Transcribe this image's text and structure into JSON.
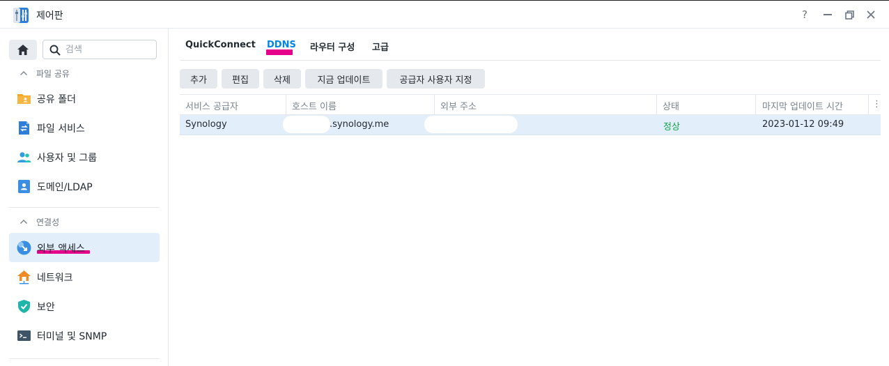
{
  "window": {
    "title": "제어판"
  },
  "window_controls": {
    "help": "?",
    "minimize": "—",
    "restore": "❐",
    "close": "✕"
  },
  "sidebar": {
    "search_placeholder": "검색",
    "sections": [
      {
        "label": "파일 공유",
        "items": [
          {
            "label": "공유 폴더",
            "icon": "shared-folder-icon",
            "color": "#f5a623"
          },
          {
            "label": "파일 서비스",
            "icon": "file-services-icon",
            "color": "#2f7fd8"
          },
          {
            "label": "사용자 및 그룹",
            "icon": "users-groups-icon",
            "color": "#2f9be0"
          },
          {
            "label": "도메인/LDAP",
            "icon": "domain-ldap-icon",
            "color": "#3a8fe3"
          }
        ]
      },
      {
        "label": "연결성",
        "items": [
          {
            "label": "외부 액세스",
            "icon": "external-access-icon",
            "color": "#3a8fe3",
            "active": true
          },
          {
            "label": "네트워크",
            "icon": "network-icon",
            "color": "#f08a24"
          },
          {
            "label": "보안",
            "icon": "security-shield-icon",
            "color": "#1fb5a8"
          },
          {
            "label": "터미널 및 SNMP",
            "icon": "terminal-icon",
            "color": "#3d5566"
          }
        ]
      }
    ]
  },
  "tabs": [
    {
      "label": "QuickConnect",
      "active": false
    },
    {
      "label": "DDNS",
      "active": true
    },
    {
      "label": "라우터 구성",
      "active": false
    },
    {
      "label": "고급",
      "active": false
    }
  ],
  "toolbar": {
    "add": "추가",
    "edit": "편집",
    "delete": "삭제",
    "update_now": "지금 업데이트",
    "customize_provider": "공급자 사용자 지정"
  },
  "grid": {
    "columns": [
      "서비스 공급자",
      "호스트 이름",
      "외부 주소",
      "상태",
      "마지막 업데이트 시간"
    ],
    "rows": [
      {
        "provider": "Synology",
        "hostname": ".synology.me",
        "external_address": "",
        "status": "정상",
        "last_update": "2023-01-12 09:49"
      }
    ],
    "menu_glyph": "⋮"
  },
  "colors": {
    "accent": "#0086e5",
    "status_ok": "#13a14b",
    "highlight_mark": "#e5008a",
    "selection": "#e3eefb"
  }
}
